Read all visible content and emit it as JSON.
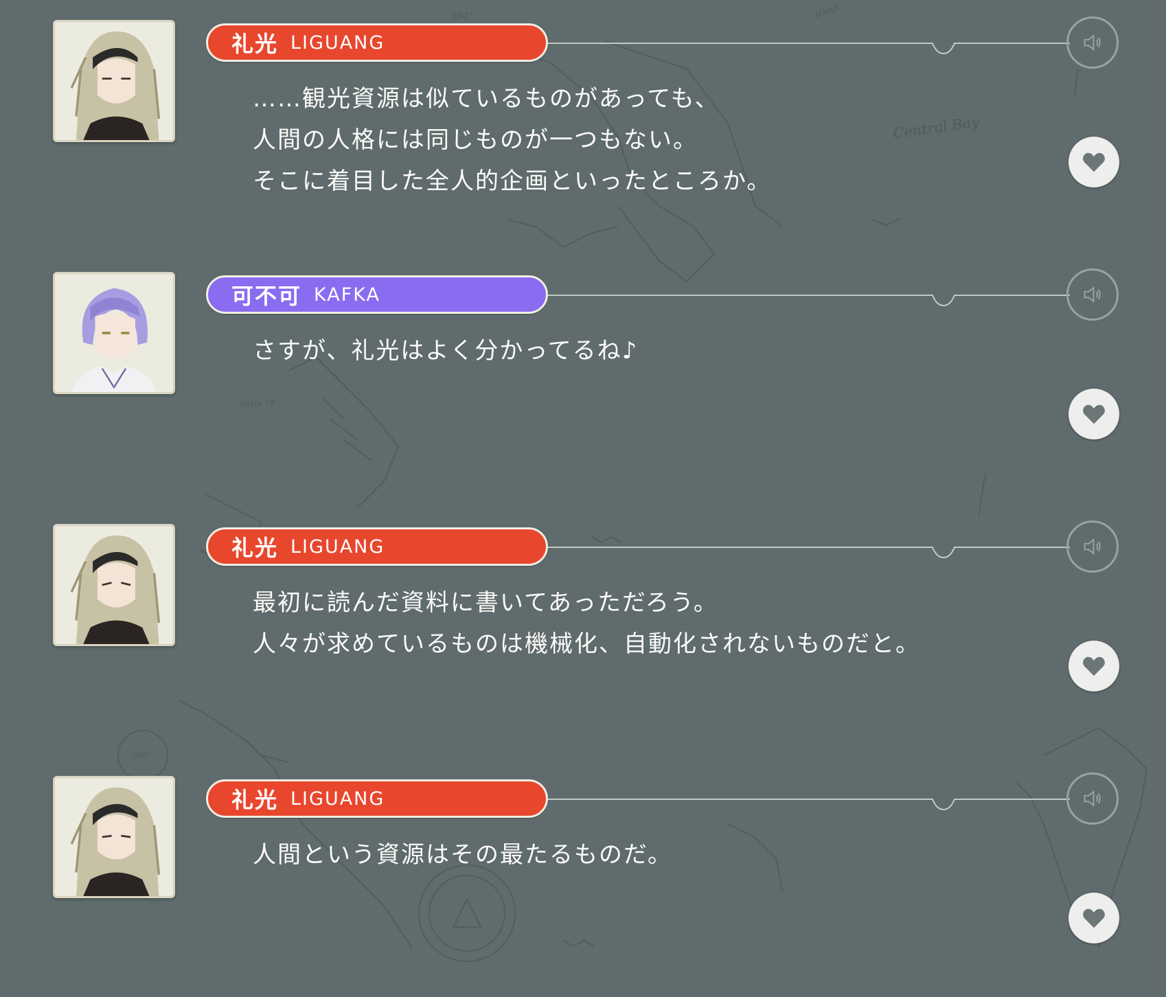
{
  "map": {
    "bay_label": "Central Bay",
    "tag_a": "094°",
    "tag_b": "030°",
    "tag_c": "HAMA",
    "tag_d": "HAMA",
    "tag_e": "18"
  },
  "colors": {
    "background": "#5f6b6c",
    "liguang_pill": "#e8472e",
    "kafka_pill": "#8a6cf0",
    "text": "#fbfbf8",
    "heart": "#6d7677"
  },
  "entries": [
    {
      "speaker_jp": "礼光",
      "speaker_en": "LIGUANG",
      "pill_color": "#e8472e",
      "avatar": "liguang-portrait",
      "lines": [
        "……観光資源は似ているものがあっても、",
        "人間の人格には同じものが一つもない。",
        "そこに着目した全人的企画といったところか。"
      ]
    },
    {
      "speaker_jp": "可不可",
      "speaker_en": "KAFKA",
      "pill_color": "#8a6cf0",
      "avatar": "kafka-portrait",
      "lines": [
        "さすが、礼光はよく分かってるね♪"
      ]
    },
    {
      "speaker_jp": "礼光",
      "speaker_en": "LIGUANG",
      "pill_color": "#e8472e",
      "avatar": "liguang-portrait",
      "lines": [
        "最初に読んだ資料に書いてあっただろう。",
        "人々が求めているものは機械化、自動化されないものだと。"
      ]
    },
    {
      "speaker_jp": "礼光",
      "speaker_en": "LIGUANG",
      "pill_color": "#e8472e",
      "avatar": "liguang-portrait",
      "lines": [
        "人間という資源はその最たるものだ。"
      ]
    }
  ],
  "icons": {
    "voice": "speaker-icon",
    "favorite": "heart-icon"
  }
}
